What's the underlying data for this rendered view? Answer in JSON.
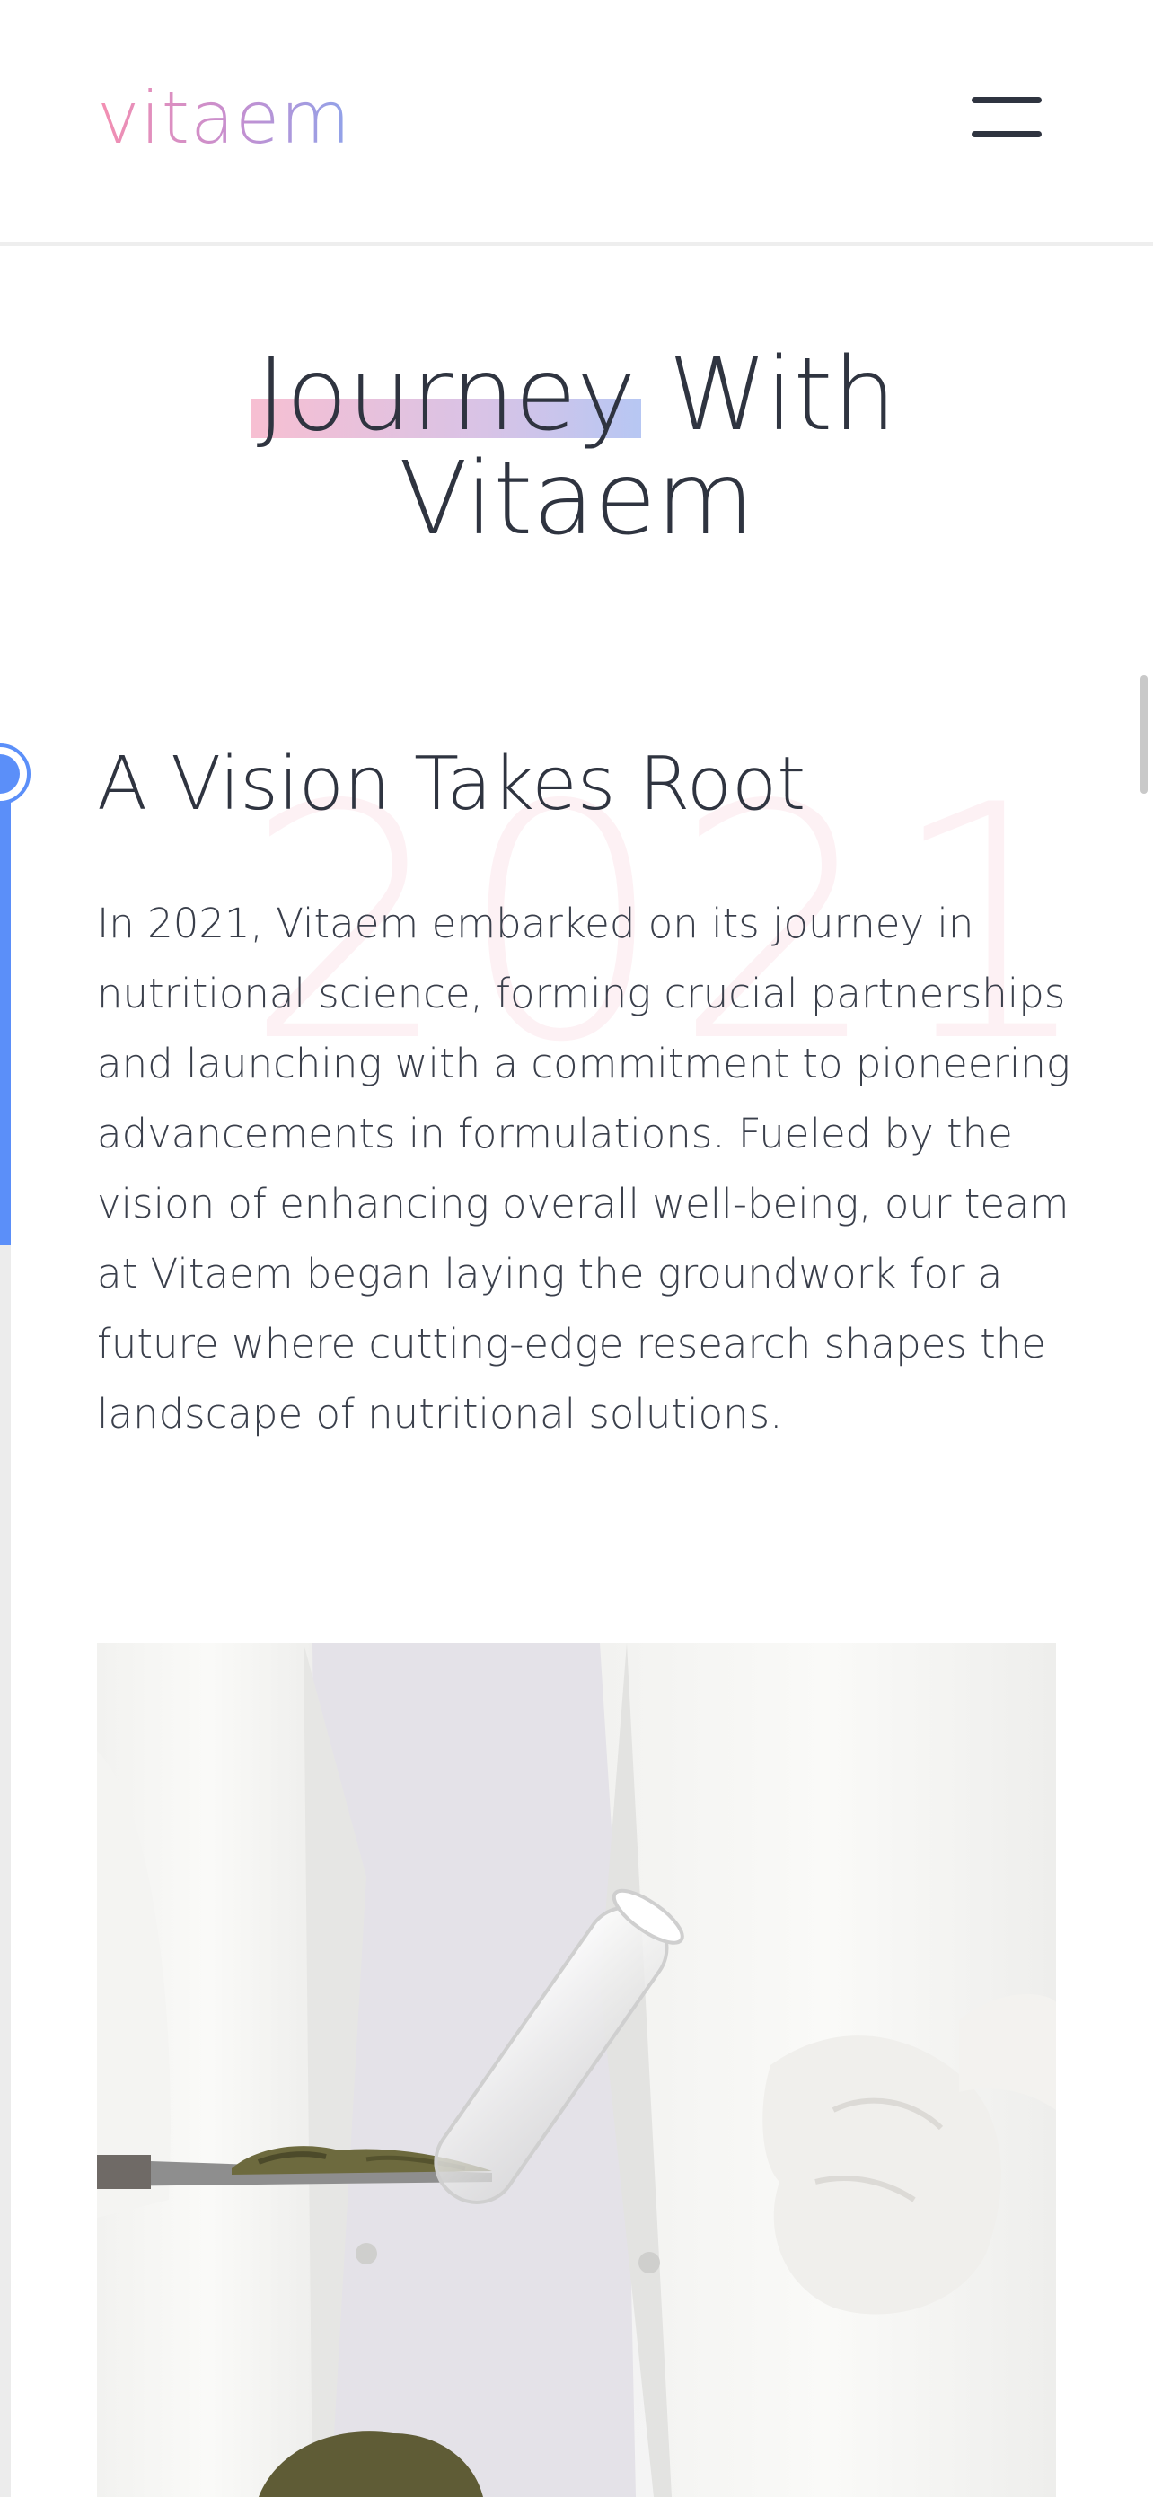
{
  "header": {
    "logo_text": "vitaem",
    "menu_icon": "hamburger-menu-icon"
  },
  "hero": {
    "title_highlight": "Journey",
    "title_line1_rest": " With",
    "title_line2": "Vitaem"
  },
  "timeline": {
    "items": [
      {
        "year": "2021",
        "title": "A Vision Takes Root",
        "body": "In 2021, Vitaem embarked on its journey in nutritional science, forming crucial partnerships and launching with a commitment to pioneering advancements in formulations. Fueled by the vision of enhancing overall well-being, our team at Vitaem began laying the groundwork for a future where cutting-edge research shapes the landscape of nutritional solutions.",
        "image": "lab-researcher-with-test-tube-and-herbs-photo",
        "progress": 0.27
      }
    ]
  },
  "colors": {
    "text": "#2f3440",
    "accent_blue": "#5b8ff9",
    "logo_gradient_start": "#f48fb1",
    "logo_gradient_end": "#8fa3ea",
    "highlight_pink": "#f7bfd2",
    "highlight_blue": "#b7c7f3"
  }
}
